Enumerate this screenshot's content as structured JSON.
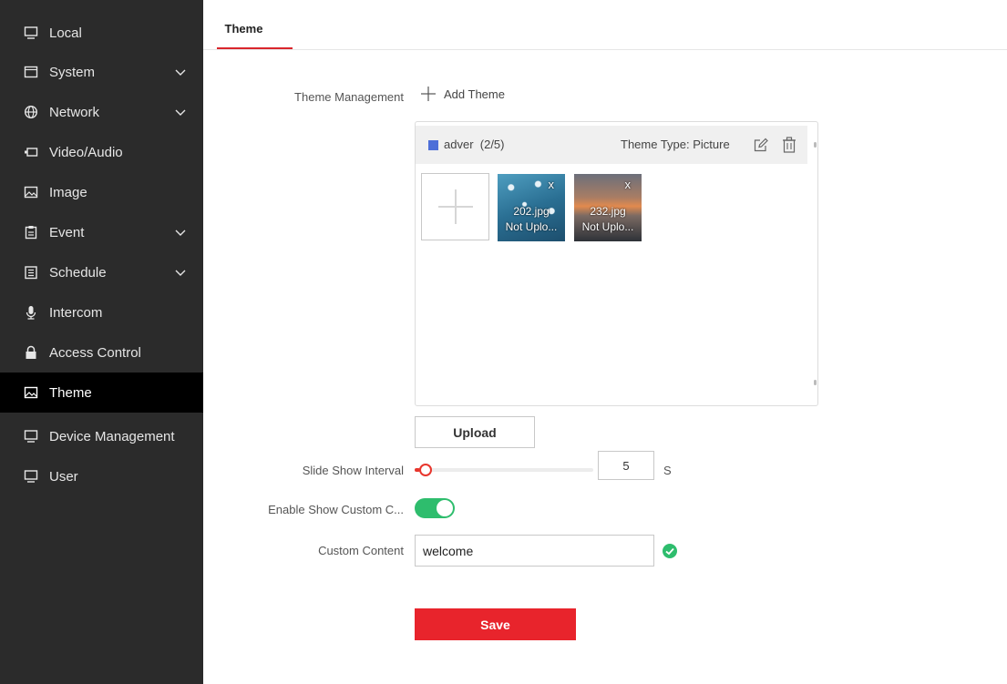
{
  "sidebar": {
    "items": [
      {
        "label": "Local",
        "icon": "monitor-icon",
        "chevron": false,
        "active": false
      },
      {
        "label": "System",
        "icon": "window-icon",
        "chevron": true,
        "active": false
      },
      {
        "label": "Network",
        "icon": "globe-icon",
        "chevron": true,
        "active": false
      },
      {
        "label": "Video/Audio",
        "icon": "camera-icon",
        "chevron": false,
        "active": false
      },
      {
        "label": "Image",
        "icon": "image-icon",
        "chevron": false,
        "active": false
      },
      {
        "label": "Event",
        "icon": "clipboard-icon",
        "chevron": true,
        "active": false
      },
      {
        "label": "Schedule",
        "icon": "calendar-icon",
        "chevron": true,
        "active": false
      },
      {
        "label": "Intercom",
        "icon": "microphone-icon",
        "chevron": false,
        "active": false
      },
      {
        "label": "Access Control",
        "icon": "lock-icon",
        "chevron": false,
        "active": false
      },
      {
        "label": "Theme",
        "icon": "image-icon",
        "chevron": false,
        "active": true
      },
      {
        "label": "Device Management",
        "icon": "monitor-icon",
        "chevron": false,
        "active": false
      },
      {
        "label": "User",
        "icon": "monitor-icon",
        "chevron": false,
        "active": false
      }
    ]
  },
  "tab": {
    "label": "Theme"
  },
  "theme_management": {
    "label": "Theme Management",
    "add_label": "Add Theme",
    "theme": {
      "name": "adver",
      "count": "(2/5)",
      "type_label": "Theme Type: Picture",
      "square_color": "#4d6fd8"
    },
    "pictures": [
      {
        "name": "202.jpg",
        "status": "Not Uplo...",
        "close": "x"
      },
      {
        "name": "232.jpg",
        "status": "Not Uplo...",
        "close": "x"
      }
    ]
  },
  "upload_label": "Upload",
  "slide_show": {
    "label": "Slide Show Interval",
    "value": "5",
    "unit": "S",
    "slider_fraction": 0.0
  },
  "custom_show": {
    "label": "Enable Show Custom C...",
    "enabled": true
  },
  "custom_content": {
    "label": "Custom Content",
    "value": "welcome"
  },
  "save_label": "Save",
  "colors": {
    "accent": "#e8242c",
    "toggle_on": "#2ebd6d",
    "sidebar_bg": "#2b2b2b",
    "sidebar_active": "#000000"
  }
}
